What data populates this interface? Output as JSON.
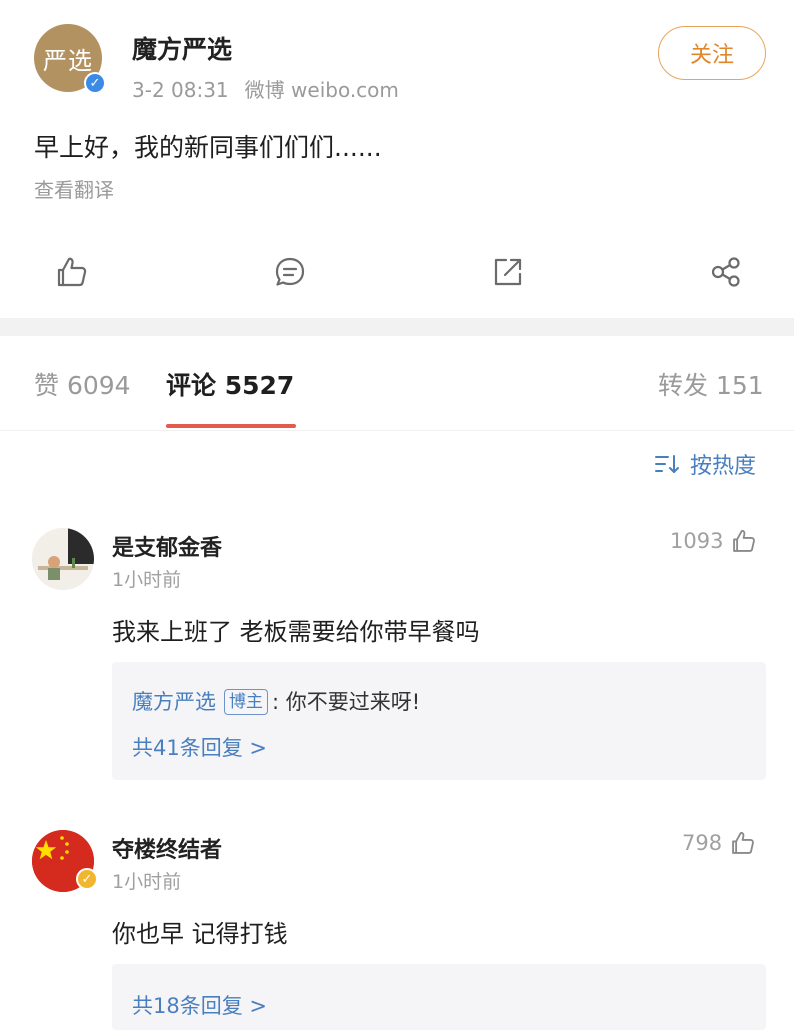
{
  "post": {
    "avatar_text": "严选",
    "author": "魔方严选",
    "time": "3-2 08:31",
    "source": "微博 weibo.com",
    "follow_label": "关注",
    "text": "早上好，我的新同事们们们......",
    "translate_label": "查看翻译"
  },
  "actions": [
    "like-icon",
    "comment-icon",
    "repost-icon",
    "share-icon"
  ],
  "tabs": {
    "likes": "赞 6094",
    "comments": "评论 5527",
    "reposts": "转发 151"
  },
  "sort_label": "按热度",
  "comments": [
    {
      "name": "是支郁金香",
      "time": "1小时前",
      "text": "我来上班了 老板需要给你带早餐吗",
      "likes": "1093",
      "reply": {
        "author": "魔方严选",
        "badge": "博主",
        "text": ": 你不要过来呀!",
        "more": "共41条回复 >"
      }
    },
    {
      "name": "夺楼终结者",
      "time": "1小时前",
      "text": "你也早 记得打钱",
      "likes": "798",
      "reply": {
        "more": "共18条回复 >"
      }
    }
  ],
  "colors": {
    "accent_orange": "#e2862c",
    "link_blue": "#4a7fbf",
    "tab_underline": "#e55a4e",
    "avatar_gold": "#b39261"
  }
}
